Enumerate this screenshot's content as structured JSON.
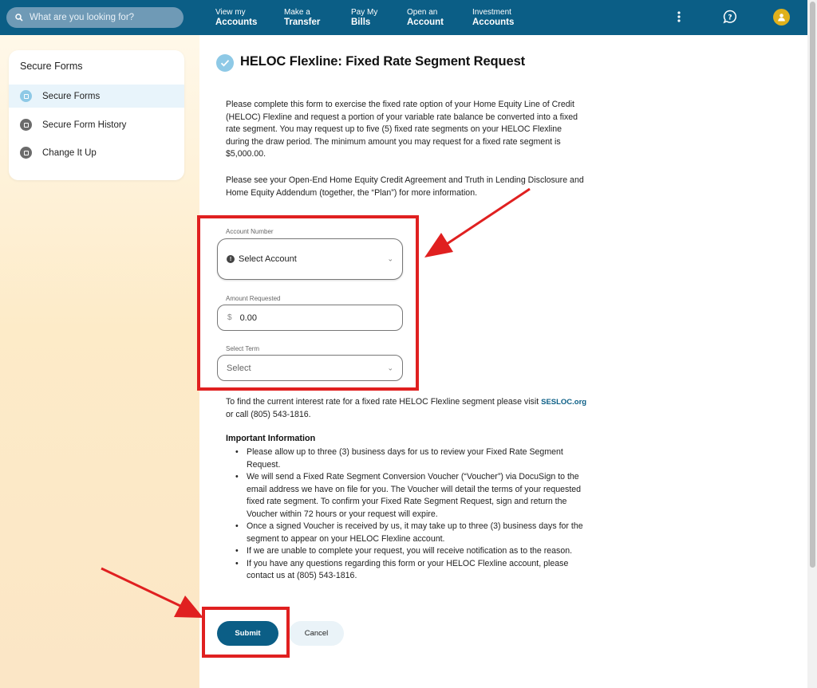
{
  "header": {
    "search_placeholder": "What are you looking for?",
    "nav": [
      {
        "line1": "View my",
        "line2": "Accounts"
      },
      {
        "line1": "Make a",
        "line2": "Transfer"
      },
      {
        "line1": "Pay My",
        "line2": "Bills"
      },
      {
        "line1": "Open an",
        "line2": "Account"
      },
      {
        "line1": "Investment",
        "line2": "Accounts"
      }
    ],
    "colors": {
      "bar": "#0b5e86",
      "avatar": "#e0b11c"
    }
  },
  "sidebar": {
    "title": "Secure Forms",
    "items": [
      {
        "label": "Secure Forms",
        "active": true
      },
      {
        "label": "Secure Form History",
        "active": false
      },
      {
        "label": "Change It Up",
        "active": false
      }
    ]
  },
  "main": {
    "title": "HELOC Flexline: Fixed Rate Segment Request",
    "intro_lines": [
      "Please complete this form to exercise the fixed rate option of your Home Equity Line of Credit",
      "(HELOC) Flexline and request a portion of your variable rate balance be converted into a fixed",
      "rate segment. You may request up to five (5) fixed rate segments on your HELOC Flexline",
      "during the draw period. The minimum amount you may request for a fixed rate segment is",
      "$5,000.00."
    ],
    "plan_lines": [
      "Please see your Open-End Home Equity Credit Agreement and Truth in Lending Disclosure and",
      "Home Equity Addendum (together, the “Plan”) for more information."
    ],
    "form": {
      "account_label": "Account Number",
      "account_value": "Select Account",
      "amount_label": "Amount Requested",
      "amount_currency": "$",
      "amount_value": "0.00",
      "term_label": "Select Term",
      "term_value": "Select"
    },
    "rate_text_1": "To find the current interest rate for a fixed rate HELOC Flexline segment please visit",
    "rate_link": "SESLOC.org",
    "rate_text_2": "or call (805) 543-1816.",
    "info_title": "Important Information",
    "bullets": [
      [
        "Please allow up to three (3) business days for us to review your Fixed Rate Segment",
        "Request."
      ],
      [
        "We will send a Fixed Rate Segment Conversion Voucher (“Voucher”) via DocuSign to the",
        "email address we have on file for you. The Voucher will detail the terms of your requested",
        "fixed rate segment. To confirm your Fixed Rate Segment Request, sign and return the",
        "Voucher within 72 hours or your request will expire."
      ],
      [
        "Once a signed Voucher is received by us, it may take up to three (3) business days for the",
        "segment to appear on your HELOC Flexline account."
      ],
      [
        "If we are unable to complete your request, you will receive notification as to the reason."
      ],
      [
        "If you have any questions regarding this form or your HELOC Flexline account, please",
        "contact us at (805) 543-1816."
      ]
    ],
    "submit_label": "Submit",
    "cancel_label": "Cancel"
  },
  "annotation_color": "#e02020"
}
